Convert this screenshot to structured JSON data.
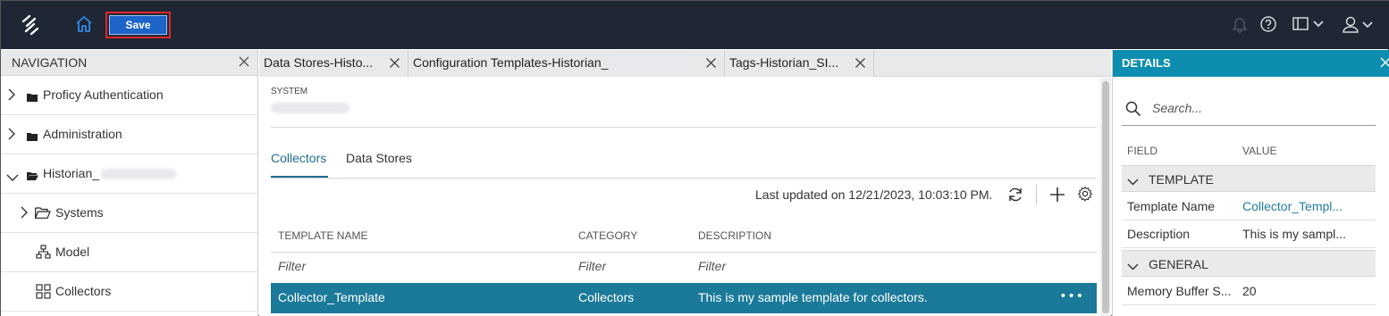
{
  "toolbar": {
    "save_label": "Save"
  },
  "navigation": {
    "title": "NAVIGATION",
    "items": [
      {
        "label": "Proficy Authentication",
        "icon": "folder-icon",
        "expandable": true
      },
      {
        "label": "Administration",
        "icon": "folder-icon",
        "expandable": true
      },
      {
        "label": "Historian_",
        "icon": "folder-open-icon",
        "expandable": true,
        "expanded": true
      },
      {
        "label": "Systems",
        "icon": "folder-outline-icon",
        "expandable": true
      },
      {
        "label": "Model",
        "icon": "hierarchy-icon",
        "expandable": false
      },
      {
        "label": "Collectors",
        "icon": "grid-icon",
        "expandable": false
      }
    ]
  },
  "tabs": [
    {
      "label": "Data Stores-Histo..."
    },
    {
      "label": "Configuration Templates-Historian_"
    },
    {
      "label": "Tags-Historian_SI..."
    }
  ],
  "main": {
    "system_label": "SYSTEM",
    "tabs": [
      {
        "label": "Collectors",
        "active": true
      },
      {
        "label": "Data Stores",
        "active": false
      }
    ],
    "last_updated": "Last updated on 12/21/2023, 10:03:10 PM.",
    "columns": [
      "TEMPLATE NAME",
      "CATEGORY",
      "DESCRIPTION"
    ],
    "filter_placeholder": "Filter",
    "rows": [
      {
        "name": "Collector_Template",
        "category": "Collectors",
        "description": "This is my sample template for collectors.",
        "more": "•••"
      }
    ]
  },
  "details": {
    "title": "DETAILS",
    "search_placeholder": "Search...",
    "field_header": "FIELD",
    "value_header": "VALUE",
    "sections": [
      {
        "title": "TEMPLATE",
        "rows": [
          {
            "field": "Template Name",
            "value": "Collector_Templ..."
          },
          {
            "field": "Description",
            "value": "This is my sampl..."
          }
        ]
      },
      {
        "title": "GENERAL",
        "rows": [
          {
            "field": "Memory Buffer S...",
            "value": "20"
          }
        ]
      }
    ]
  },
  "colors": {
    "topbar": "#1e2733",
    "save_button": "#1d64c8",
    "highlight_border": "#e0262e",
    "selected_row": "#1b7a99",
    "details_header": "#0d8eb0",
    "accent": "#1f6d94"
  }
}
